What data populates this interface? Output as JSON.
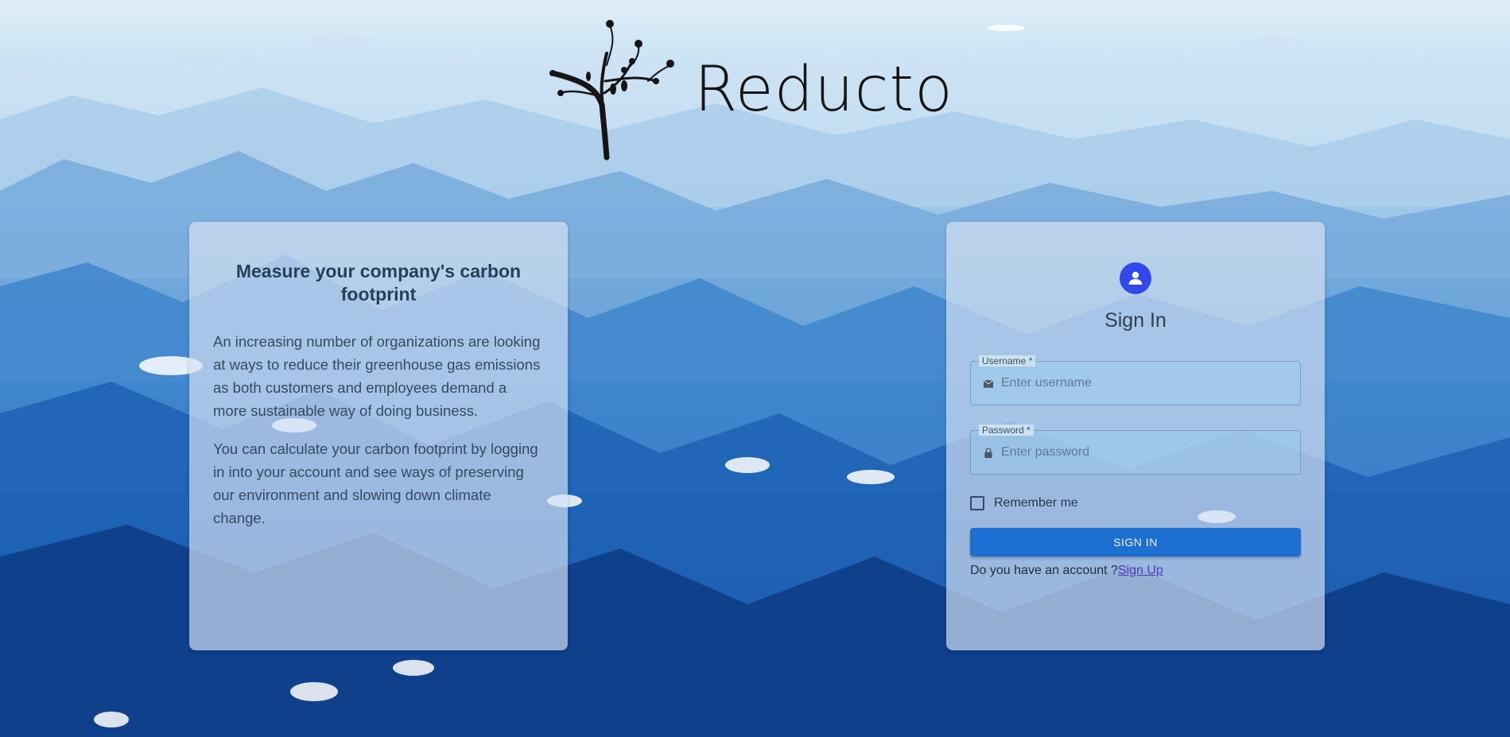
{
  "brand": {
    "name": "Reducto"
  },
  "info": {
    "title": "Measure your company's carbon footprint",
    "paragraphs": [
      "An increasing number of organizations are looking at ways to reduce their greenhouse gas emissions as both customers and employees demand a more sustainable way of doing business.",
      "You can calculate your carbon footprint by logging in into your account and see ways of preserving our environment and slowing down climate change."
    ]
  },
  "login": {
    "avatar_icon": "person-icon",
    "title": "Sign In",
    "username": {
      "label": "Username *",
      "placeholder": "Enter username",
      "icon": "mail-icon",
      "value": ""
    },
    "password": {
      "label": "Password *",
      "placeholder": "Enter password",
      "icon": "lock-icon",
      "value": ""
    },
    "remember_label": "Remember me",
    "remember_checked": false,
    "submit_label": "SIGN IN",
    "signup_prompt": "Do you have an account ?",
    "signup_link": "Sign Up"
  },
  "colors": {
    "accent": "#3148ec",
    "button": "#1d6fd1",
    "link": "#4a3dbf",
    "card_background": "rgba(214,226,242,0.68)"
  }
}
